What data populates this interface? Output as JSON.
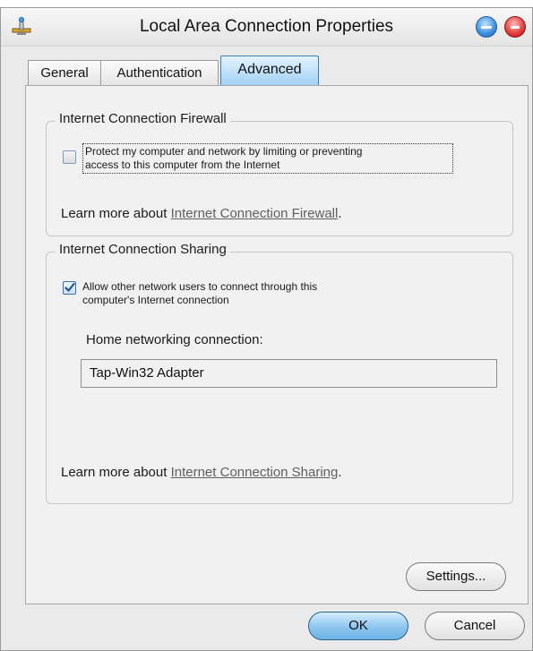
{
  "window": {
    "title": "Local Area Connection Properties"
  },
  "tabs": [
    {
      "label": "General"
    },
    {
      "label": "Authentication"
    },
    {
      "label": "Advanced"
    }
  ],
  "firewall": {
    "legend": "Internet Connection Firewall",
    "checkbox_line1": "Protect my computer and network by limiting or preventing",
    "checkbox_line2": "access to this computer from the Internet",
    "checked": false,
    "learn_prefix": "Learn more about ",
    "learn_link": "Internet Connection Firewall",
    "learn_suffix": "."
  },
  "sharing": {
    "legend": "Internet Connection Sharing",
    "checkbox_line1": "Allow other network users to connect through this",
    "checkbox_line2": "computer's Internet connection",
    "checked": true,
    "home_label": "Home networking connection:",
    "home_value": "Tap-Win32 Adapter",
    "learn_prefix": "Learn more about ",
    "learn_link": "Internet Connection Sharing",
    "learn_suffix": "."
  },
  "buttons": {
    "settings": "Settings...",
    "ok": "OK",
    "cancel": "Cancel"
  },
  "colors": {
    "ok_button": "#8cc5ee",
    "active_tab": "#9fd0f5",
    "close_button": "#e23a3a",
    "minimize_button": "#3d8ee0"
  },
  "icons": [
    "network-connection-icon",
    "minimize-icon",
    "close-icon",
    "checkmark-icon"
  ]
}
